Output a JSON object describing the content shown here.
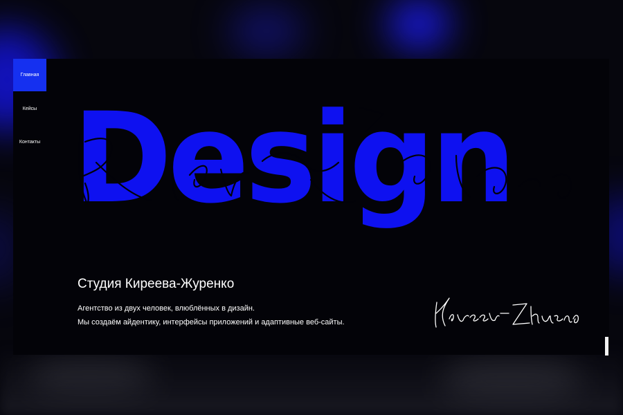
{
  "nav": {
    "items": [
      {
        "label": "Главная",
        "active": true
      },
      {
        "label": "Кейсы",
        "active": false
      },
      {
        "label": "Контакты",
        "active": false
      }
    ]
  },
  "hero": {
    "word": "Design",
    "scribble_text": "Kireev-Zhurenko"
  },
  "studio": {
    "title": "Студия Киреева-Журенко",
    "line1": "Агентство из двух человек, влюблённых в дизайн.",
    "line2": "Мы создаём айдентику, интерфейсы приложений и адаптивные веб-сайты."
  },
  "signature": {
    "text": "Kireev-Zhurenko"
  },
  "colors": {
    "accent": "#1530f0",
    "hero": "#0e11f0",
    "background": "#030308",
    "text": "#ffffff"
  }
}
